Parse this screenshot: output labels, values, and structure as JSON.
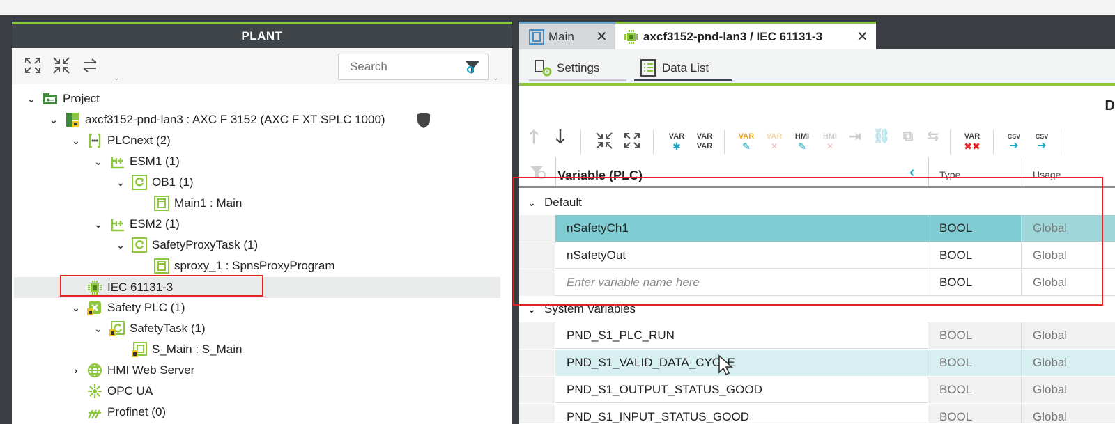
{
  "plant": {
    "title": "PLANT",
    "search_placeholder": "Search"
  },
  "tree": [
    {
      "label": "Project",
      "icon": "project-icon",
      "chevron": "down"
    },
    {
      "label": "axcf3152-pnd-lan3 : AXC F 3152 (AXC F XT SPLC 1000)",
      "icon": "controller-icon",
      "chevron": "down"
    },
    {
      "label": "PLCnext (2)",
      "icon": "plcnext-icon",
      "chevron": "down"
    },
    {
      "label": "ESM1 (1)",
      "icon": "esm-icon",
      "chevron": "down"
    },
    {
      "label": "OB1 (1)",
      "icon": "task-icon",
      "chevron": "down"
    },
    {
      "label": "Main1 : Main",
      "icon": "program-instance-icon",
      "chevron": ""
    },
    {
      "label": "ESM2 (1)",
      "icon": "esm-icon",
      "chevron": "down"
    },
    {
      "label": "SafetyProxyTask (1)",
      "icon": "task-icon",
      "chevron": "down"
    },
    {
      "label": "sproxy_1 : SpnsProxyProgram",
      "icon": "program-instance-icon",
      "chevron": ""
    },
    {
      "label": "IEC 61131-3",
      "icon": "iec-chip-icon",
      "chevron": ""
    },
    {
      "label": "Safety PLC (1)",
      "icon": "safety-plc-icon",
      "chevron": "down"
    },
    {
      "label": "SafetyTask (1)",
      "icon": "safety-task-icon",
      "chevron": "down"
    },
    {
      "label": "S_Main : S_Main",
      "icon": "safety-program-icon",
      "chevron": ""
    },
    {
      "label": "HMI Web Server",
      "icon": "globe-icon",
      "chevron": "right"
    },
    {
      "label": "OPC UA",
      "icon": "opcua-icon",
      "chevron": ""
    },
    {
      "label": "Profinet (0)",
      "icon": "profinet-icon",
      "chevron": ""
    }
  ],
  "tabs": {
    "main": "Main",
    "active": "axcf3152-pnd-lan3 / IEC 61131-3"
  },
  "subtabs": {
    "settings": "Settings",
    "datalist": "Data List"
  },
  "edge_letter": "D",
  "toolbar": {
    "var": "VAR",
    "hmi": "HMI",
    "csv": "CSV"
  },
  "grid": {
    "headers": {
      "variable": "Variable (PLC)",
      "type": "Type",
      "usage": "Usage"
    },
    "groups": {
      "default": "Default",
      "system": "System Variables"
    },
    "default_rows": [
      {
        "name": "nSafetyCh1",
        "type": "BOOL",
        "usage": "Global"
      },
      {
        "name": "nSafetyOut",
        "type": "BOOL",
        "usage": "Global"
      }
    ],
    "new_row": {
      "placeholder": "Enter variable name here",
      "type": "BOOL",
      "usage": "Global"
    },
    "system_rows": [
      {
        "name": "PND_S1_PLC_RUN",
        "type": "BOOL",
        "usage": "Global"
      },
      {
        "name": "PND_S1_VALID_DATA_CYCLE",
        "type": "BOOL",
        "usage": "Global"
      },
      {
        "name": "PND_S1_OUTPUT_STATUS_GOOD",
        "type": "BOOL",
        "usage": "Global"
      },
      {
        "name": "PND_S1_INPUT_STATUS_GOOD",
        "type": "BOOL",
        "usage": "Global"
      }
    ]
  },
  "colors": {
    "accent_green": "#8dc63f",
    "selection": "#7fccd2",
    "highlight_red": "#e32222"
  }
}
